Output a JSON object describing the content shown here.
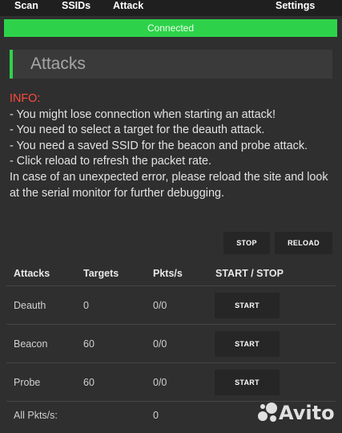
{
  "nav": {
    "items": [
      {
        "label": "Scan"
      },
      {
        "label": "SSIDs"
      },
      {
        "label": "Attack"
      },
      {
        "label": "Settings"
      }
    ]
  },
  "status": {
    "label": "Connected",
    "color": "#2ed24a"
  },
  "page_title": "Attacks",
  "info": {
    "label": "INFO:",
    "lines": [
      "- You might lose connection when starting an attack!",
      "- You need to select a target for the deauth attack.",
      "- You need a saved SSID for the beacon and probe attack.",
      "- Click reload to refresh the packet rate.",
      "In case of an unexpected error, please reload the site and look at the serial monitor for further debugging."
    ]
  },
  "controls": {
    "stop_label": "STOP",
    "reload_label": "RELOAD"
  },
  "table": {
    "headers": [
      "Attacks",
      "Targets",
      "Pkts/s",
      "START / STOP"
    ],
    "rows": [
      {
        "attack": "Deauth",
        "targets": "0",
        "pkts": "0/0",
        "action": "START"
      },
      {
        "attack": "Beacon",
        "targets": "60",
        "pkts": "0/0",
        "action": "START"
      },
      {
        "attack": "Probe",
        "targets": "60",
        "pkts": "0/0",
        "action": "START"
      }
    ],
    "total": {
      "label": "All Pkts/s:",
      "value": "0"
    }
  },
  "watermark": {
    "text": "Avito"
  }
}
